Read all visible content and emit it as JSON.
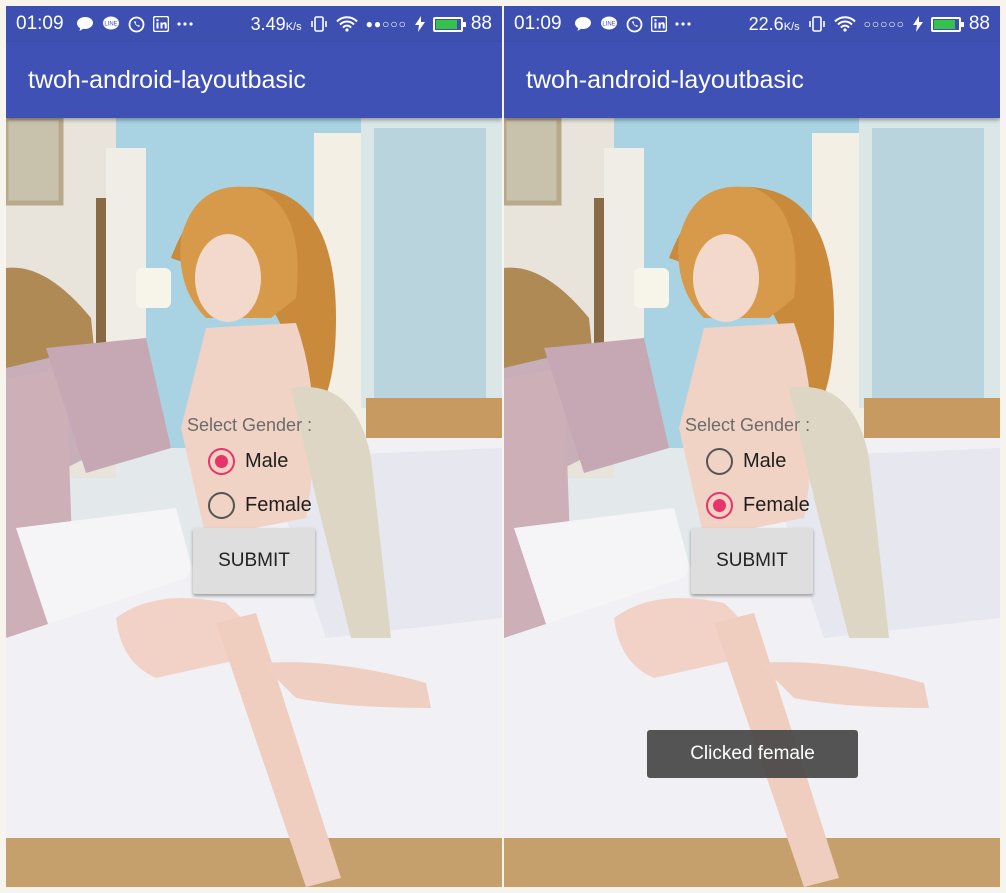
{
  "screens": [
    {
      "status_bar": {
        "time": "01:09",
        "icons": [
          "chat-bubble-icon",
          "line-icon",
          "whatsapp-icon",
          "linkedin-icon",
          "more-dots-icon"
        ],
        "net_speed": "3.49",
        "net_unit": "K/s",
        "signal_dots": "●●○○○",
        "battery_level": "88",
        "battery_color": "#35c24a"
      },
      "app_bar": {
        "title": "twoh-android-layoutbasic"
      },
      "form": {
        "label": "Select Gender :",
        "options": [
          {
            "label": "Male",
            "checked": true
          },
          {
            "label": "Female",
            "checked": false
          }
        ],
        "submit_label": "SUBMIT"
      }
    },
    {
      "status_bar": {
        "time": "01:09",
        "icons": [
          "chat-bubble-icon",
          "line-icon",
          "whatsapp-icon",
          "linkedin-icon",
          "more-dots-icon"
        ],
        "net_speed": "22.6",
        "net_unit": "K/s",
        "signal_dots": "○○○○○",
        "battery_level": "88",
        "battery_color": "#35c24a"
      },
      "app_bar": {
        "title": "twoh-android-layoutbasic"
      },
      "form": {
        "label": "Select Gender :",
        "options": [
          {
            "label": "Male",
            "checked": false
          },
          {
            "label": "Female",
            "checked": true
          }
        ],
        "submit_label": "SUBMIT"
      },
      "toast": "Clicked female"
    }
  ],
  "colors": {
    "app_bar": "#3f51b5",
    "status_bar": "#3d4fb0",
    "radio_accent": "#e8336b"
  }
}
